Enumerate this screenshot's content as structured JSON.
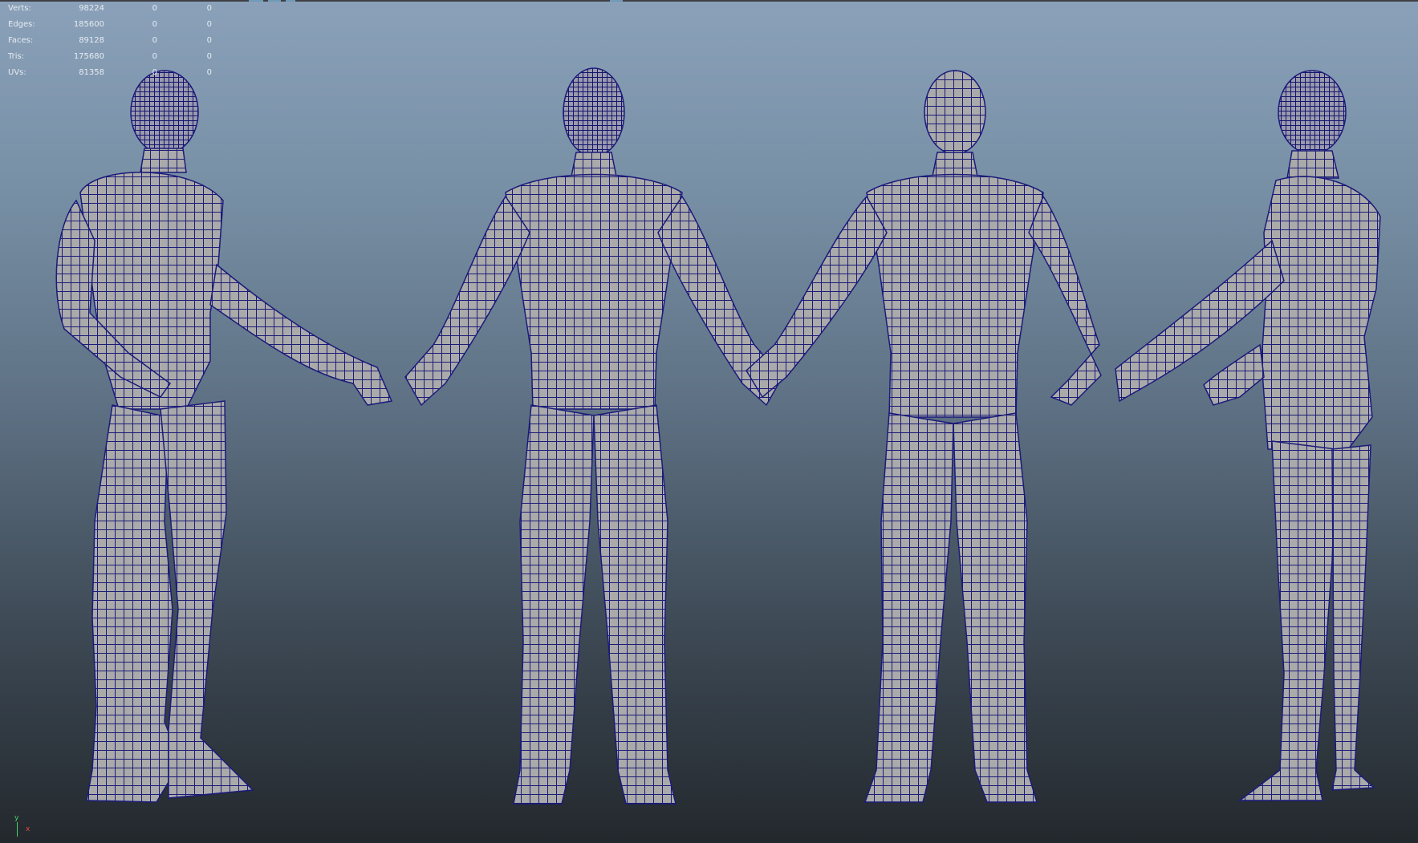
{
  "stats": [
    {
      "label": "Verts:",
      "v1": "98224",
      "v2": "0",
      "v3": "0"
    },
    {
      "label": "Edges:",
      "v1": "185600",
      "v2": "0",
      "v3": "0"
    },
    {
      "label": "Faces:",
      "v1": "89128",
      "v2": "0",
      "v3": "0"
    },
    {
      "label": "Tris:",
      "v1": "175680",
      "v2": "0",
      "v3": "0"
    },
    {
      "label": "UVs:",
      "v1": "81358",
      "v2": "0",
      "v3": "0"
    }
  ],
  "axis": {
    "y": "y",
    "x": "x"
  },
  "colors": {
    "wire": "#1a1a78",
    "skin": "#a9a9a9",
    "bg_top": "#8aa1b9",
    "bg_bottom": "#23282d"
  }
}
